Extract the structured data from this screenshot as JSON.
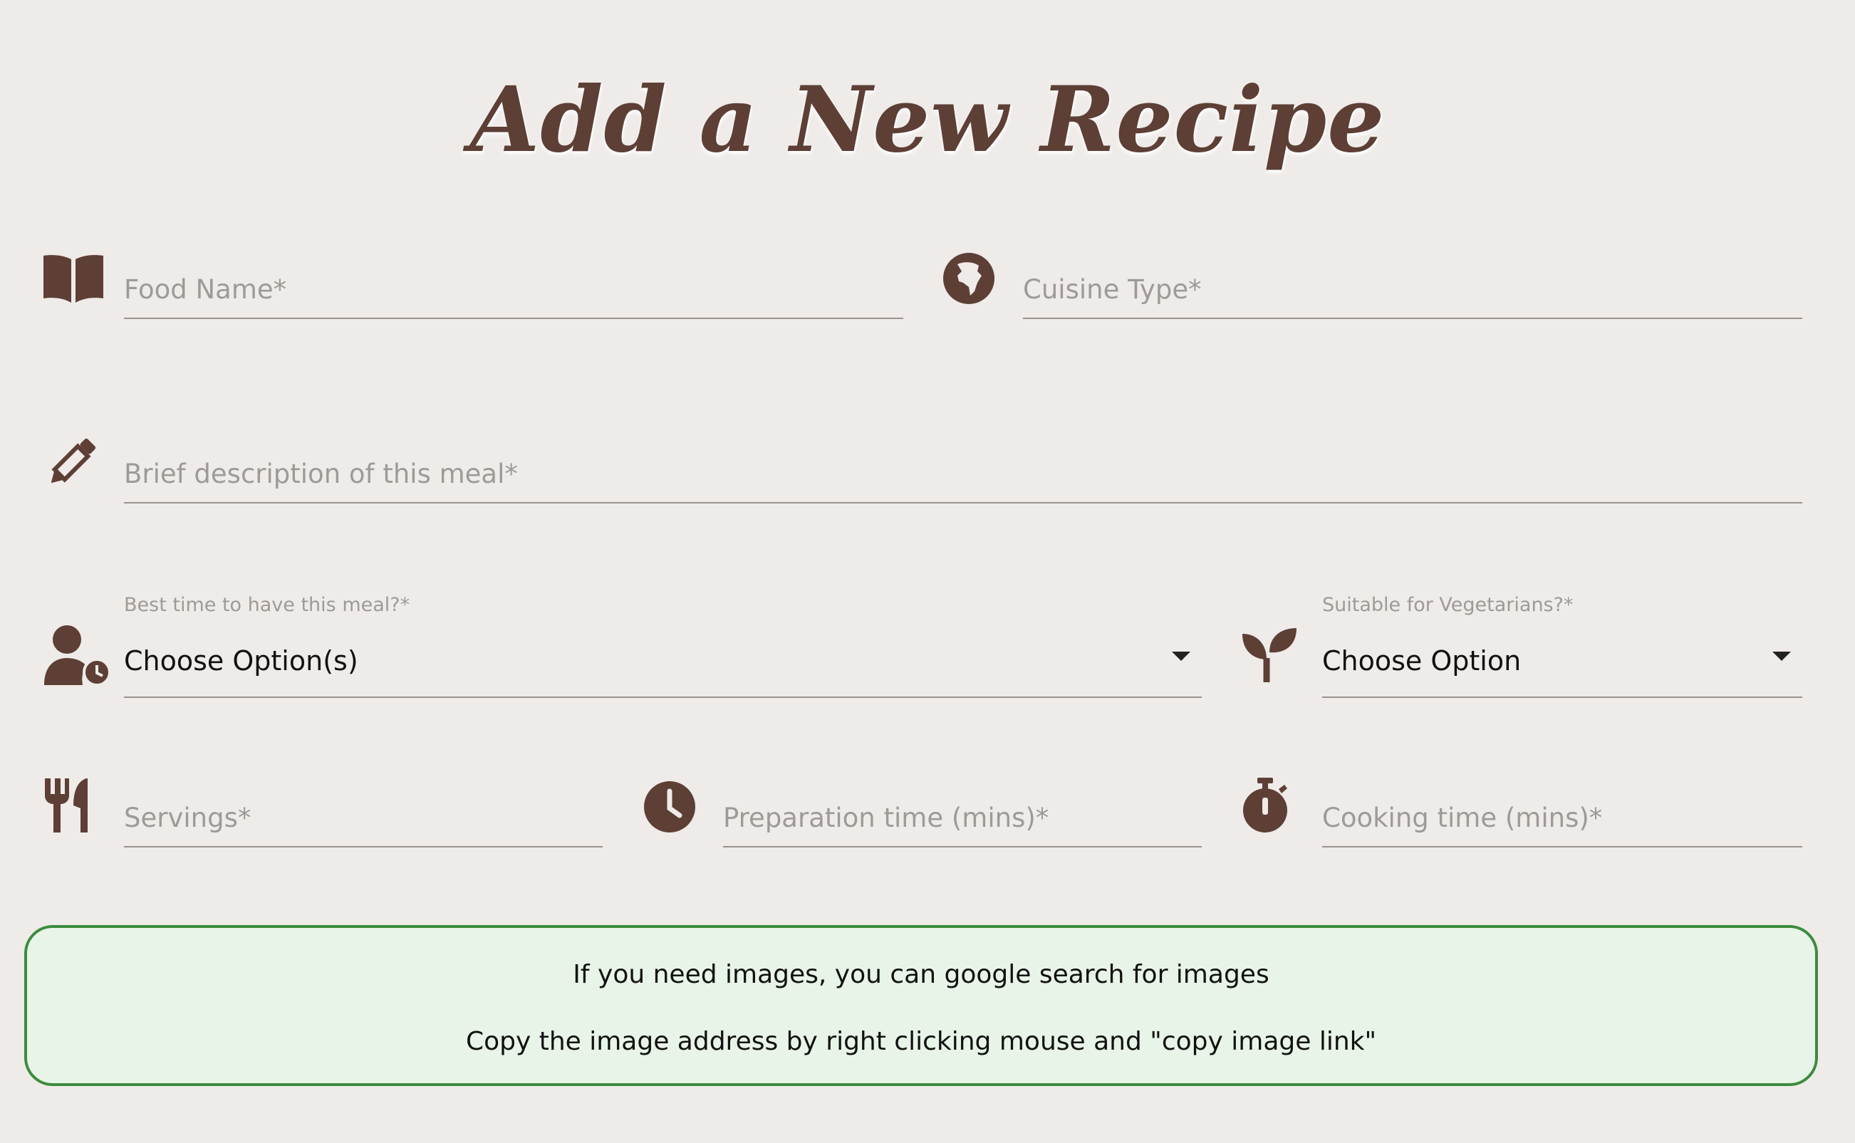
{
  "page": {
    "title": "Add a New Recipe"
  },
  "colors": {
    "background": "#efebe8",
    "icon": "#5d3f36",
    "info_bg": "#e8f4e7",
    "info_border": "#3c8c3e"
  },
  "fields": {
    "food_name": {
      "placeholder": "Food Name*",
      "icon": "book-open-icon"
    },
    "cuisine_type": {
      "placeholder": "Cuisine Type*",
      "icon": "globe-africa-icon"
    },
    "description": {
      "placeholder": "Brief description of this meal*",
      "icon": "pencil-icon"
    },
    "servings": {
      "placeholder": "Servings*",
      "icon": "utensils-icon"
    },
    "prep_time": {
      "placeholder": "Preparation time (mins)*",
      "icon": "clock-icon"
    },
    "cook_time": {
      "placeholder": "Cooking time (mins)*",
      "icon": "stopwatch-icon"
    }
  },
  "selects": {
    "meal_time": {
      "label": "Best time to have this meal?*",
      "value": "Choose Option(s)",
      "icon": "user-clock-icon"
    },
    "vegetarian": {
      "label": "Suitable for Vegetarians?*",
      "value": "Choose Option",
      "icon": "seedling-icon"
    }
  },
  "info": {
    "line1": "If you need images, you can google search for images",
    "line2": "Copy the image address by right clicking mouse and \"copy image link\""
  }
}
